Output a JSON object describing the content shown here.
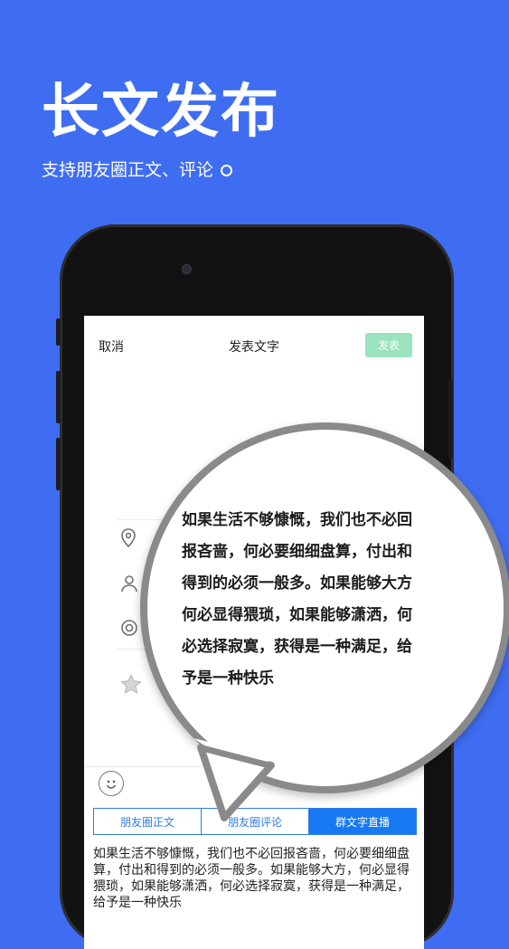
{
  "hero": {
    "title": "长文发布",
    "subtitle": "支持朋友圈正文、评论"
  },
  "nav": {
    "cancel": "取消",
    "title": "发表文字",
    "publish": "发表"
  },
  "tabs": [
    {
      "label": "朋友圈正文",
      "active": false
    },
    {
      "label": "朋友圈评论",
      "active": false
    },
    {
      "label": "群文字直播",
      "active": true
    }
  ],
  "body_text": "如果生活不够慷慨，我们也不必回报吝啬，何必要细细盘算，付出和得到的必须一般多。如果能够大方，何必显得猥琐，如果能够潇洒，何必选择寂寞，获得是一种满足，给予是一种快乐",
  "magnifier": {
    "lines": [
      "如果生活不够慷慨，我们也不必回",
      "报吝啬，何必要细细盘算，付出和",
      "得到的必须一般多。如果能够大方",
      "何必显得猥琐，如果能够潇洒，何",
      "必选择寂寞，获得是一种满足，给",
      "予是一种快乐"
    ]
  },
  "icons": [
    "location-icon",
    "person-icon",
    "at-icon",
    "star-icon",
    "emoji-icon"
  ],
  "colors": {
    "background": "#3f6df2",
    "tab_accent": "#1779f2",
    "publish_disabled": "#9ae3bf"
  }
}
